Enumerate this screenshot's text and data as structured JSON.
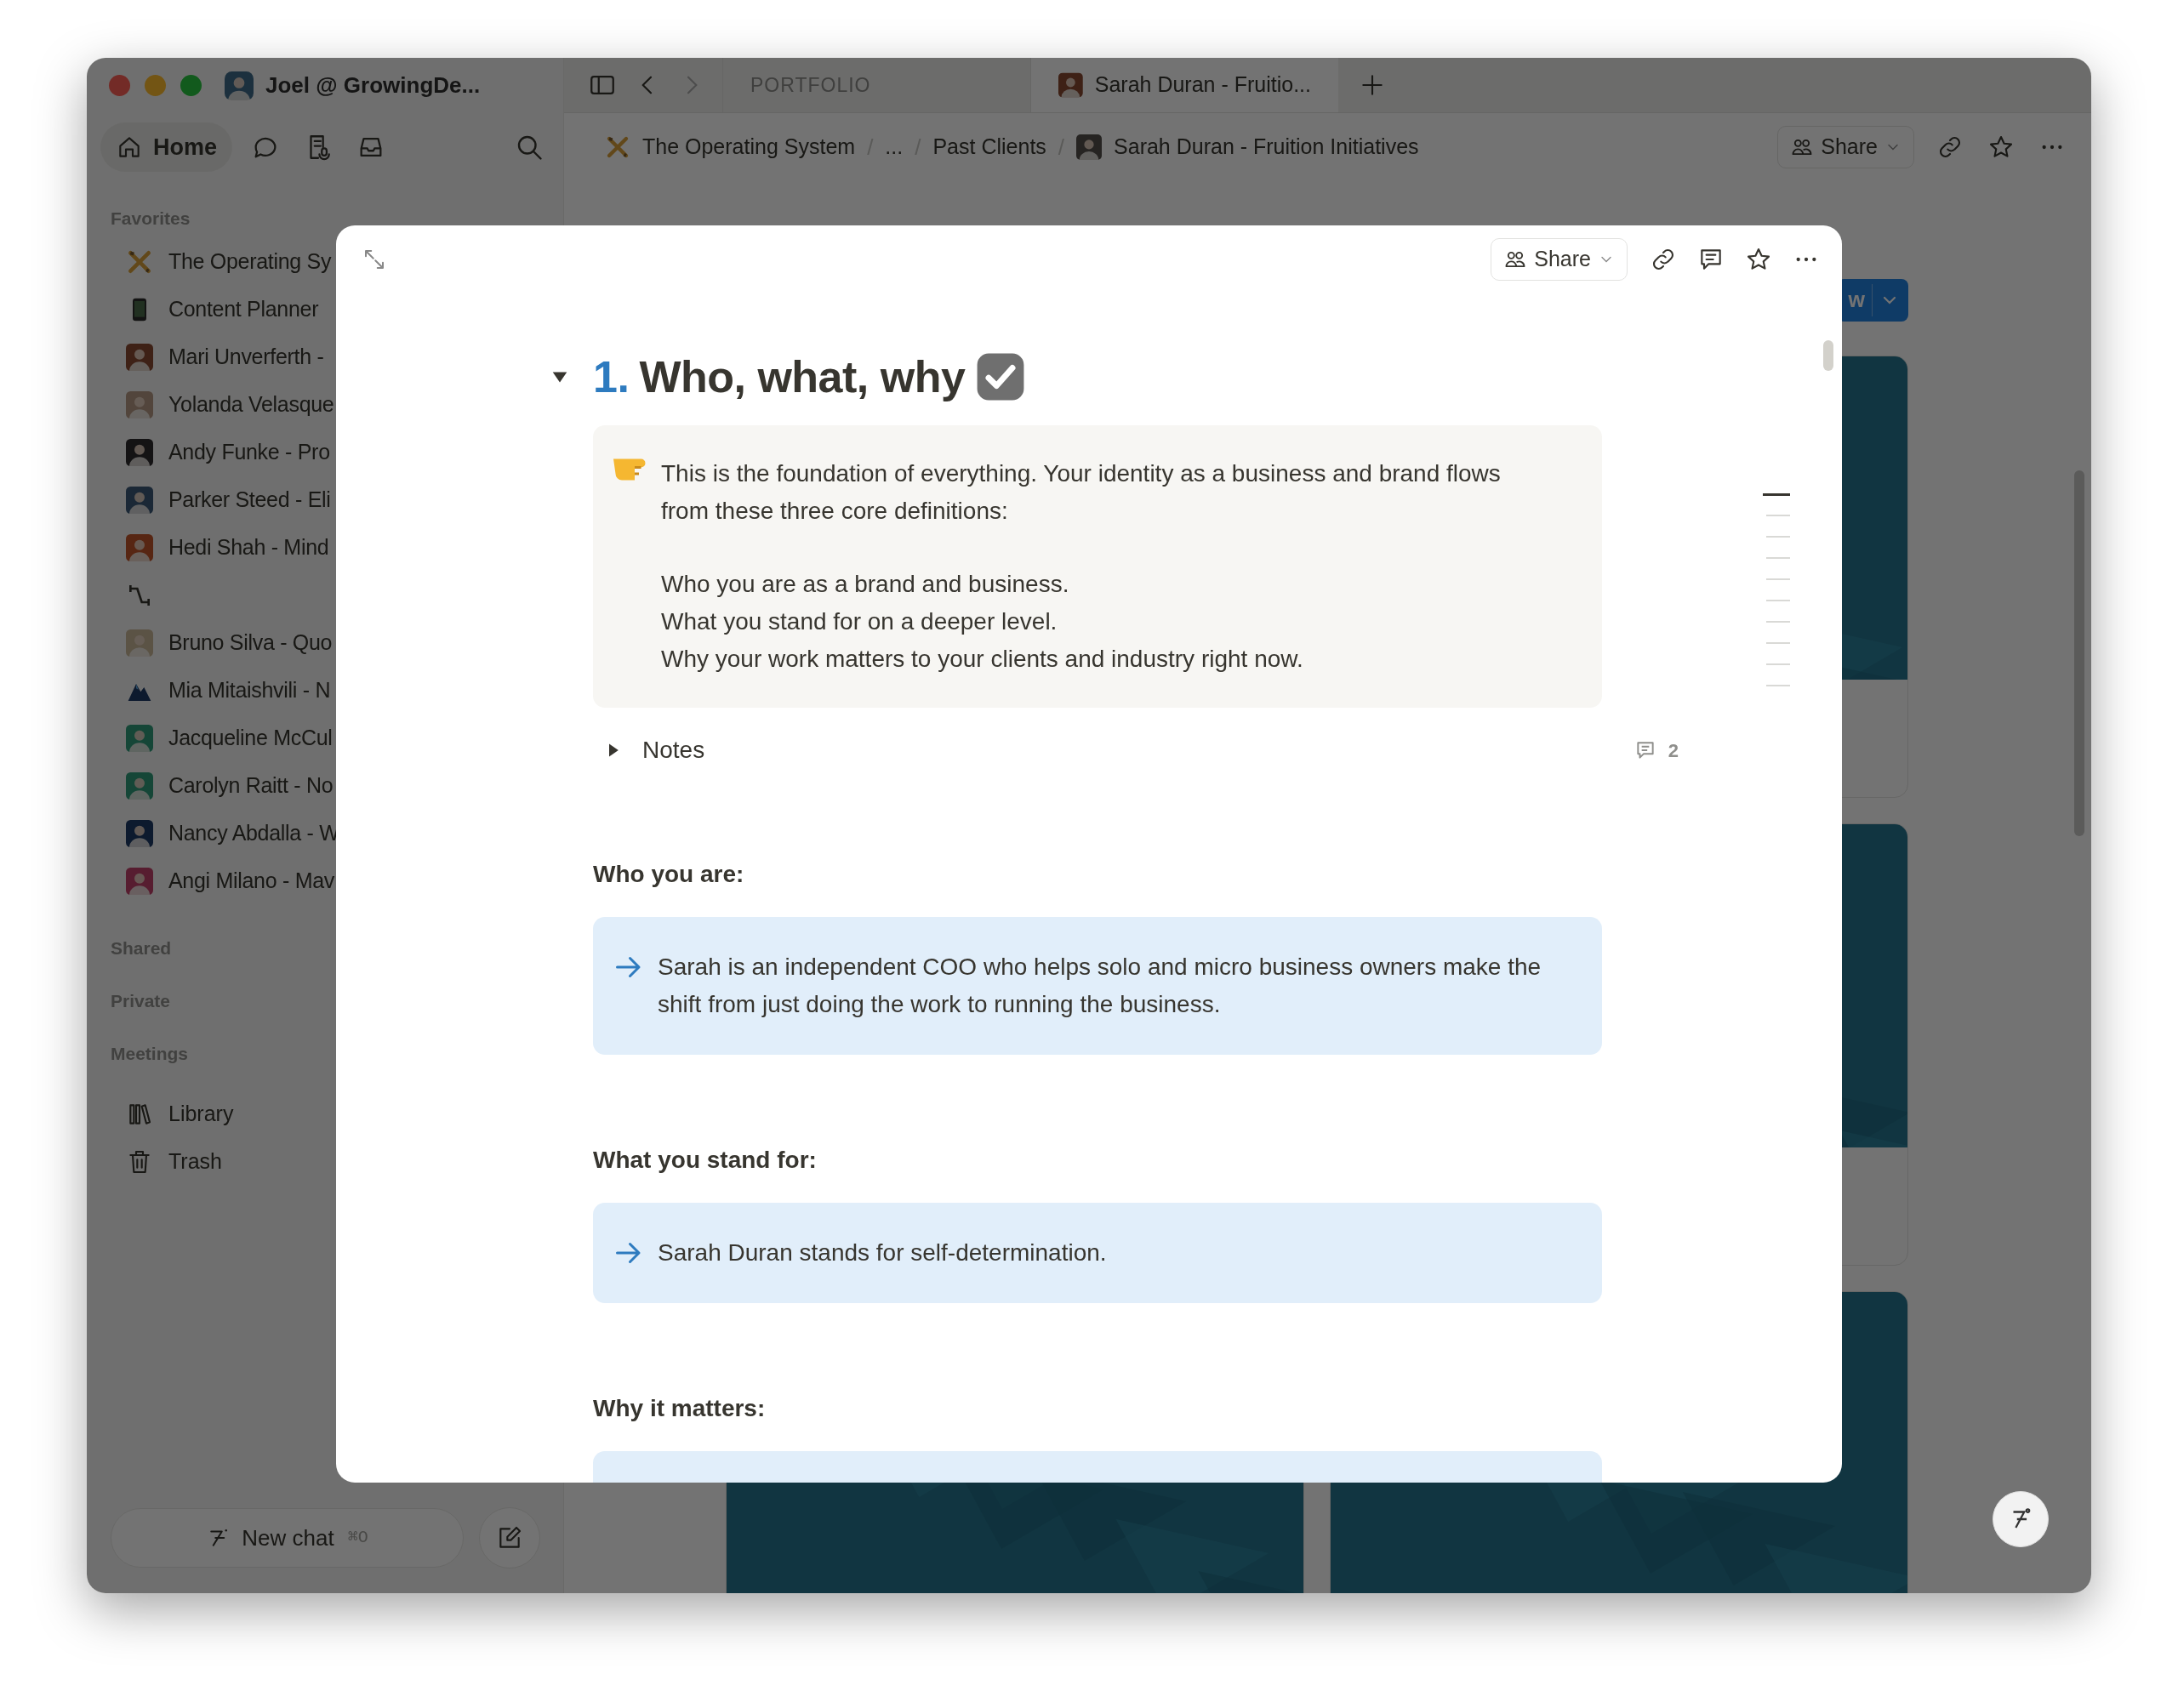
{
  "titlebar": {
    "workspace": "Joel @ GrowingDe..."
  },
  "tabs": [
    {
      "label": "PORTFOLIO",
      "selected": false,
      "kind": "section"
    },
    {
      "label": "Sarah Duran - Fruitio...",
      "selected": true,
      "kind": "page"
    }
  ],
  "breadcrumb": [
    {
      "label": "The Operating System",
      "kind": "pencils"
    },
    {
      "separator": "/",
      "label": "...",
      "kind": "text"
    },
    {
      "separator": "/",
      "label": "Past Clients",
      "kind": "text"
    },
    {
      "separator": "/",
      "label": "Sarah Duran - Fruition Initiatives",
      "kind": "avatar"
    }
  ],
  "page_toolbar": {
    "share": "Share"
  },
  "sidebar": {
    "home": "Home",
    "favorites_label": "Favorites",
    "favorites": [
      {
        "label": "The Operating Sy",
        "kind": "pencils"
      },
      {
        "label": "Content Planner",
        "kind": "phone"
      },
      {
        "label": "Mari Unverferth -",
        "kind": "avatar"
      },
      {
        "label": "Yolanda Velasque",
        "kind": "avatar"
      },
      {
        "label": "Andy Funke - Pro",
        "kind": "avatar"
      },
      {
        "label": "Parker Steed - Eli",
        "kind": "avatar"
      },
      {
        "label": "Hedi Shah - Mind",
        "kind": "avatar"
      },
      {
        "kind": "arrows"
      },
      {
        "label": "Bruno Silva - Quo",
        "kind": "avatar"
      },
      {
        "label": "Mia Mitaishvili - N",
        "kind": "mountain"
      },
      {
        "label": "Jacqueline McCul",
        "kind": "avatar"
      },
      {
        "label": "Carolyn Raitt - No",
        "kind": "avatar"
      },
      {
        "label": "Nancy Abdalla - W",
        "kind": "avatar"
      },
      {
        "label": "Angi Milano - Mav",
        "kind": "avatar"
      }
    ],
    "sections": [
      "Shared",
      "Private",
      "Meetings"
    ],
    "links": [
      {
        "label": "Library",
        "kind": "library"
      },
      {
        "label": "Trash",
        "kind": "trash"
      }
    ],
    "new_chat": "New chat",
    "new_chat_shortcut": "⌘O"
  },
  "board": {
    "button": "w"
  },
  "modal": {
    "share": "Share",
    "heading": {
      "number": "1.",
      "title": "Who, what, why",
      "expanded": true,
      "checked": true
    },
    "callout": {
      "intro": "This is the foundation of everything. Your identity as a business and brand flows from these three core definitions:",
      "lines": [
        "Who you are as a brand and business.",
        "What you stand for on a deeper level.",
        "Why your work matters to your clients and industry right now."
      ]
    },
    "toggle": {
      "label": "Notes",
      "expanded": false,
      "comments": "2"
    },
    "sections": [
      {
        "title": "Who you are:",
        "text": "Sarah is an independent COO who helps solo and micro business owners make the shift from just doing the work to running the business."
      },
      {
        "title": "What you stand for:",
        "text": "Sarah Duran stands for self-determination."
      },
      {
        "title": "Why it matters:"
      }
    ]
  }
}
